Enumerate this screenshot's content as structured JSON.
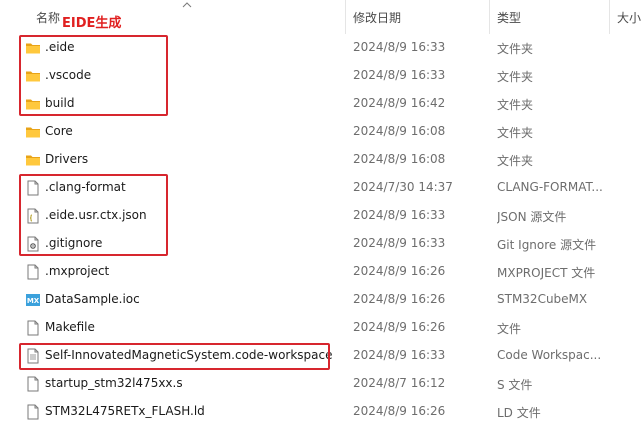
{
  "header": {
    "name_label": "名称",
    "date_label": "修改日期",
    "type_label": "类型",
    "size_label": "大小"
  },
  "annotation": {
    "label": "EIDE生成",
    "color": "#e02020"
  },
  "files": [
    {
      "name": ".eide",
      "date": "2024/8/9 16:33",
      "type": "文件夹",
      "icon": "folder-icon"
    },
    {
      "name": ".vscode",
      "date": "2024/8/9 16:33",
      "type": "文件夹",
      "icon": "folder-icon"
    },
    {
      "name": "build",
      "date": "2024/8/9 16:42",
      "type": "文件夹",
      "icon": "folder-icon"
    },
    {
      "name": "Core",
      "date": "2024/8/9 16:08",
      "type": "文件夹",
      "icon": "folder-icon"
    },
    {
      "name": "Drivers",
      "date": "2024/8/9 16:08",
      "type": "文件夹",
      "icon": "folder-icon"
    },
    {
      "name": ".clang-format",
      "date": "2024/7/30 14:37",
      "type": "CLANG-FORMAT...",
      "icon": "file-icon"
    },
    {
      "name": ".eide.usr.ctx.json",
      "date": "2024/8/9 16:33",
      "type": "JSON 源文件",
      "icon": "json-file-icon"
    },
    {
      "name": ".gitignore",
      "date": "2024/8/9 16:33",
      "type": "Git Ignore 源文件",
      "icon": "gear-file-icon"
    },
    {
      "name": ".mxproject",
      "date": "2024/8/9 16:26",
      "type": "MXPROJECT 文件",
      "icon": "file-icon"
    },
    {
      "name": "DataSample.ioc",
      "date": "2024/8/9 16:26",
      "type": "STM32CubeMX",
      "icon": "mx-icon"
    },
    {
      "name": "Makefile",
      "date": "2024/8/9 16:26",
      "type": "文件",
      "icon": "file-icon"
    },
    {
      "name": "Self-InnovatedMagneticSystem.code-workspace",
      "date": "2024/8/9 16:33",
      "type": "Code Workspac...",
      "icon": "text-file-icon"
    },
    {
      "name": "startup_stm32l475xx.s",
      "date": "2024/8/7 16:12",
      "type": "S 文件",
      "icon": "file-icon"
    },
    {
      "name": "STM32L475RETx_FLASH.ld",
      "date": "2024/8/9 16:26",
      "type": "LD 文件",
      "icon": "file-icon"
    }
  ]
}
